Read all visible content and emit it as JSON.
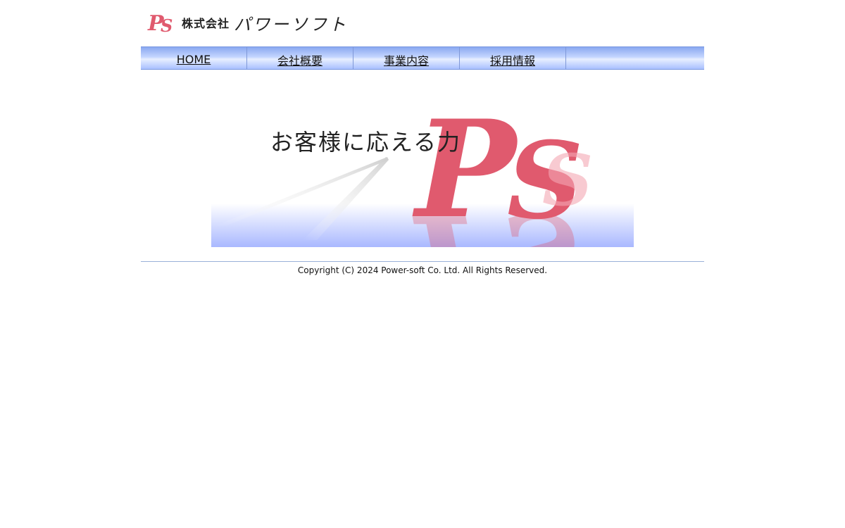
{
  "header": {
    "logo_mark": "PS",
    "company_prefix": "株式会社",
    "company_name": "パワーソフト"
  },
  "nav": {
    "items": [
      {
        "label": "HOME"
      },
      {
        "label": "会社概要"
      },
      {
        "label": "事業内容"
      },
      {
        "label": "採用情報"
      }
    ]
  },
  "banner": {
    "tagline": "お客様に応える力",
    "mark": "PS"
  },
  "footer": {
    "copyright": "Copyright (C) 2024 Power-soft Co. Ltd. All Rights Reserved."
  },
  "colors": {
    "brand": "#e05a6e",
    "nav_gradient_top": "#8aa8f0",
    "nav_gradient_bottom": "#a9c0ff",
    "banner_floor": "#a9b8ff"
  }
}
